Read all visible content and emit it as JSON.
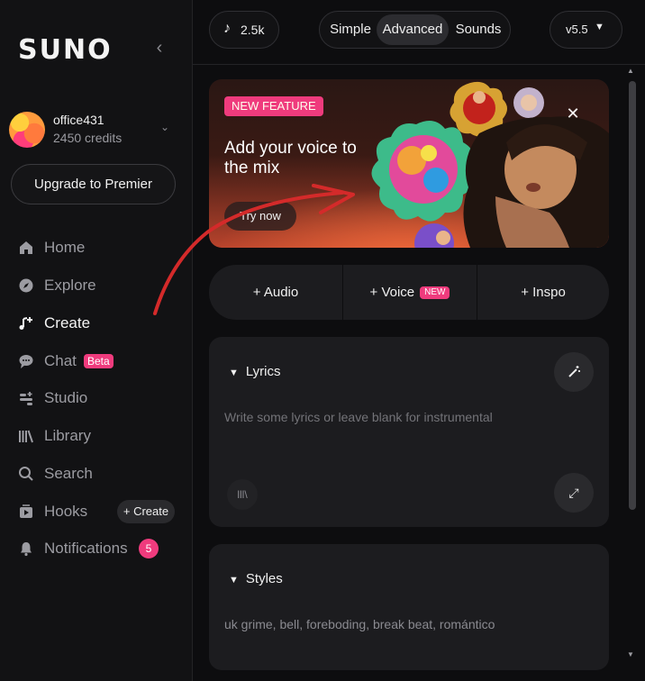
{
  "sidebar": {
    "logo": "SUNO",
    "user": {
      "name": "office431",
      "credits": "2450 credits"
    },
    "upgrade_label": "Upgrade to Premier",
    "nav": [
      {
        "label": "Home",
        "icon": "home-icon"
      },
      {
        "label": "Explore",
        "icon": "compass-icon"
      },
      {
        "label": "Create",
        "icon": "music-plus-icon",
        "active": true
      },
      {
        "label": "Chat",
        "icon": "chat-icon",
        "badge": "Beta"
      },
      {
        "label": "Studio",
        "icon": "studio-icon"
      },
      {
        "label": "Library",
        "icon": "library-icon"
      },
      {
        "label": "Search",
        "icon": "search-icon"
      },
      {
        "label": "Hooks",
        "icon": "hooks-icon",
        "action": "+ Create"
      },
      {
        "label": "Notifications",
        "icon": "bell-icon",
        "count": "5"
      }
    ]
  },
  "topbar": {
    "plays": "2.5k",
    "modes": [
      "Simple",
      "Advanced",
      "Sounds"
    ],
    "selected_mode": "Advanced",
    "version": "v5.5"
  },
  "banner": {
    "tag": "NEW FEATURE",
    "title": "Add your voice to the mix",
    "cta": "Try now"
  },
  "actions": {
    "audio": "+ Audio",
    "voice": "+ Voice",
    "voice_badge": "NEW",
    "inspo": "+ Inspo"
  },
  "lyrics": {
    "title": "Lyrics",
    "placeholder": "Write some lyrics or leave blank for instrumental"
  },
  "styles": {
    "title": "Styles",
    "value": "uk grime, bell, foreboding, break beat, romántico"
  },
  "colors": {
    "accent": "#ef3b7d",
    "annotation": "#d42a2a"
  }
}
